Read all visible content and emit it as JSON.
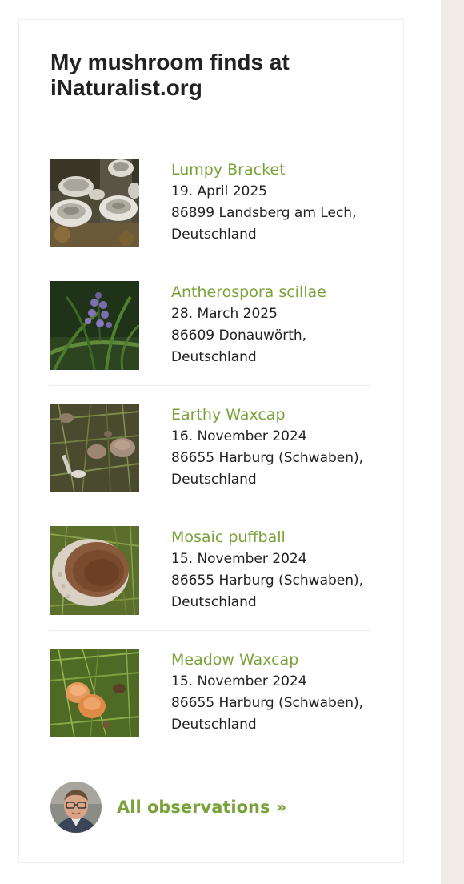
{
  "widget": {
    "title": "My mushroom finds at iNaturalist.org"
  },
  "observations": [
    {
      "name": "Lumpy Bracket",
      "date": "19. April 2025",
      "place_line1": "86899 Landsberg am Lech,",
      "place_line2": "Deutschland",
      "thumb_icon": "bracket-fungus-photo"
    },
    {
      "name": "Antherospora scillae",
      "date": "28. March 2025",
      "place_line1": "86609 Donauwörth,",
      "place_line2": "Deutschland",
      "thumb_icon": "squill-flower-photo"
    },
    {
      "name": "Earthy Waxcap",
      "date": "16. November 2024",
      "place_line1": "86655 Harburg (Schwaben),",
      "place_line2": "Deutschland",
      "thumb_icon": "waxcap-mushrooms-photo"
    },
    {
      "name": "Mosaic puffball",
      "date": "15. November 2024",
      "place_line1": "86655 Harburg (Schwaben),",
      "place_line2": "Deutschland",
      "thumb_icon": "puffball-photo"
    },
    {
      "name": "Meadow Waxcap",
      "date": "15. November 2024",
      "place_line1": "86655 Harburg (Schwaben),",
      "place_line2": "Deutschland",
      "thumb_icon": "orange-waxcap-photo"
    }
  ],
  "footer": {
    "all_link_label": "All observations »",
    "avatar_icon": "user-avatar"
  },
  "colors": {
    "accent_green": "#7aa23a",
    "title_text": "#222222",
    "body_text": "#222222",
    "divider": "#eeeeee",
    "side_strip": "#f1ece7"
  }
}
